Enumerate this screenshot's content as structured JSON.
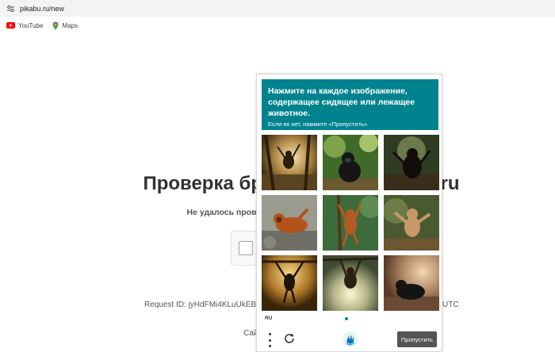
{
  "browser": {
    "url": "pikabu.ru/new",
    "bookmarks": [
      {
        "label": "YouTube",
        "icon": "youtube-icon"
      },
      {
        "label": "Maps",
        "icon": "maps-icon"
      }
    ]
  },
  "page": {
    "title": "Проверка браузера пе                        а pikabu.ru",
    "subtitle": "Не удалось проверить ваш браузер авт                                                           чную проверку",
    "request_id_left": "Request ID: jyHdFMi4KLuUkEBb",
    "request_id_right": "UTC",
    "site_text": "Сай"
  },
  "captcha": {
    "title": "Нажмите на каждое изображение, содержащее сидящее или лежащее животное.",
    "hint": "Если их нет, нажмите «Пропустить».",
    "language": "RU",
    "skip_label": "Пропустить",
    "accent_color": "#00838f",
    "tiles": [
      {
        "subject": "monkey-hanging-in-sunlit-forest"
      },
      {
        "subject": "gorilla-sitting-in-forest"
      },
      {
        "subject": "ape-in-jungle-silhouette"
      },
      {
        "subject": "orangutan-lying-on-rocks"
      },
      {
        "subject": "orangutan-hanging-from-branch"
      },
      {
        "subject": "orangutan-standing-in-jungle"
      },
      {
        "subject": "gibbon-swinging-in-sunlight"
      },
      {
        "subject": "ape-hanging-by-arms-in-sunburst"
      },
      {
        "subject": "gorilla-sitting-in-sunlight"
      }
    ]
  }
}
